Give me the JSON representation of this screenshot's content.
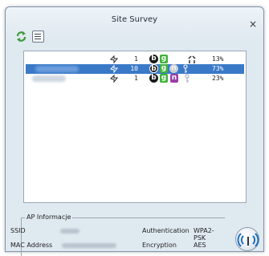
{
  "window": {
    "title": "Site Survey",
    "close_glyph": "×"
  },
  "toolbar": {
    "refresh_icon": "refresh-icon",
    "list_icon": "list-view-icon"
  },
  "networks": [
    {
      "channel": "1",
      "signal": "13%",
      "selected": false,
      "modes": [
        "b",
        "g"
      ],
      "security_icon": "broken-lock-icon"
    },
    {
      "channel": "10",
      "signal": "73%",
      "selected": true,
      "modes": [
        "b",
        "g",
        "n"
      ],
      "security_icon": "key-icon"
    },
    {
      "channel": "1",
      "signal": "23%",
      "selected": false,
      "modes": [
        "b",
        "g",
        "n"
      ],
      "security_icon": "key-icon"
    }
  ],
  "ap_info": {
    "legend": "AP Informacje",
    "ssid_label": "SSID",
    "mac_label": "MAC Address",
    "auth_label": "Authentication",
    "auth_value": "WPA2-PSK",
    "enc_label": "Encryption",
    "enc_value": "AES"
  },
  "colors": {
    "selection": "#3a79c8",
    "mode_b": "#1a1a1a",
    "mode_g": "#3fb33a",
    "mode_n": "#9a3fa8"
  }
}
